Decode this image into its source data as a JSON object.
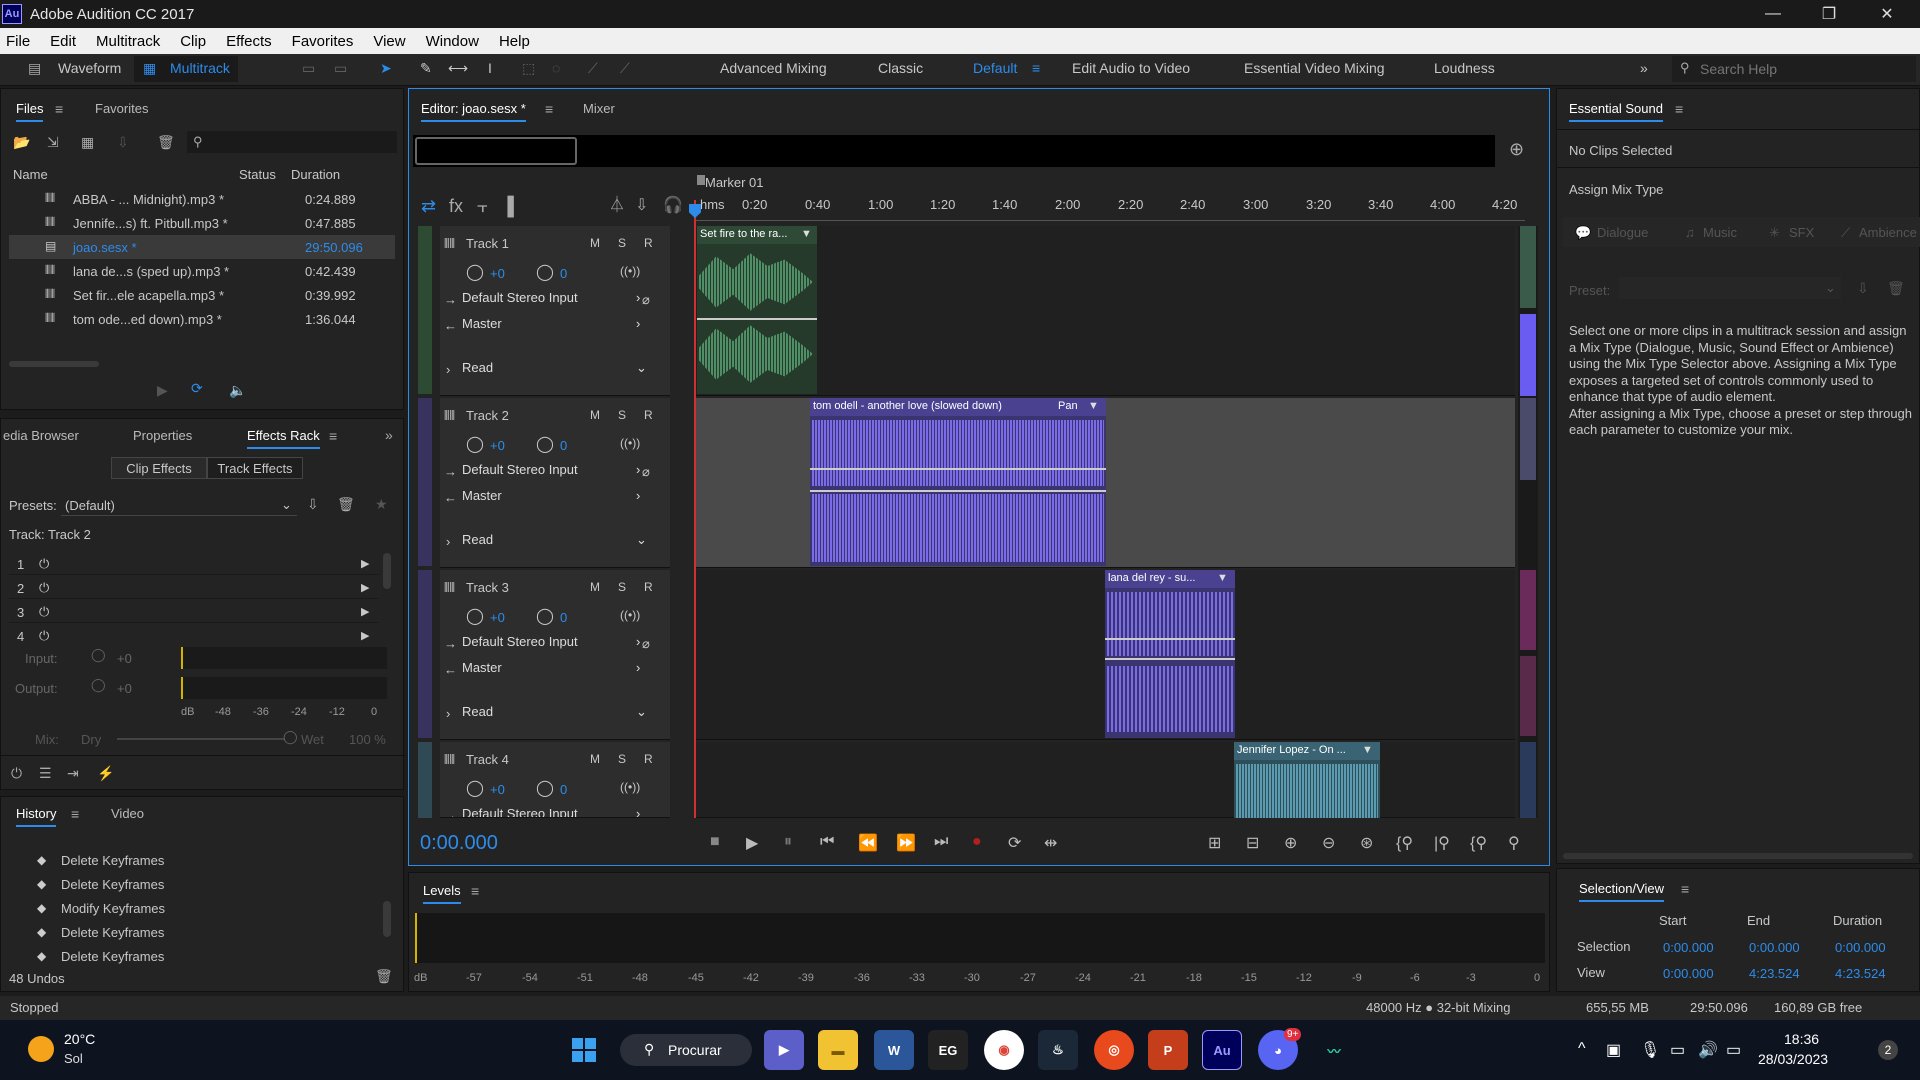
{
  "app": {
    "title": "Adobe Audition CC 2017",
    "logo": "Au"
  },
  "menu": [
    "File",
    "Edit",
    "Multitrack",
    "Clip",
    "Effects",
    "Favorites",
    "View",
    "Window",
    "Help"
  ],
  "toolbar": {
    "waveform": "Waveform",
    "multitrack": "Multitrack",
    "workspaces": [
      "Advanced Mixing",
      "Classic",
      "Default",
      "Edit Audio to Video",
      "Essential Video Mixing",
      "Loudness"
    ],
    "active_workspace": "Default",
    "search_placeholder": "Search Help"
  },
  "files_panel": {
    "tabs": [
      "Files",
      "Favorites"
    ],
    "columns": {
      "name": "Name",
      "status": "Status",
      "duration": "Duration"
    },
    "files": [
      {
        "name": "ABBA - ... Midnight).mp3 *",
        "duration": "0:24.889"
      },
      {
        "name": "Jennife...s) ft. Pitbull.mp3 *",
        "duration": "0:47.885"
      },
      {
        "name": "joao.sesx *",
        "duration": "29:50.096"
      },
      {
        "name": "lana de...s (sped up).mp3 *",
        "duration": "0:42.439"
      },
      {
        "name": "Set fir...ele acapella.mp3 *",
        "duration": "0:39.992"
      },
      {
        "name": "tom ode...ed down).mp3 *",
        "duration": "1:36.044"
      }
    ]
  },
  "effects_panel": {
    "tabs": [
      "edia Browser",
      "Properties",
      "Effects Rack"
    ],
    "subtabs": [
      "Clip Effects",
      "Track Effects"
    ],
    "presets_label": "Presets:",
    "preset_value": "(Default)",
    "track_label": "Track: Track 2",
    "slots": [
      "1",
      "2",
      "3",
      "4"
    ],
    "input_label": "Input:",
    "output_label": "Output:",
    "gain_value": "+0",
    "db_scale": [
      "dB",
      "-48",
      "-36",
      "-24",
      "-12",
      "0"
    ],
    "mix_label": "Mix:",
    "dry_label": "Dry",
    "wet_label": "Wet",
    "wet_value": "100 %"
  },
  "history_panel": {
    "tabs": [
      "History",
      "Video"
    ],
    "items": [
      "Delete Keyframes",
      "Delete Keyframes",
      "Modify Keyframes",
      "Delete Keyframes",
      "Delete Keyframes"
    ],
    "undos": "48 Undos"
  },
  "editor": {
    "tabs": [
      "Editor: joao.sesx *",
      "Mixer"
    ],
    "marker": "Marker 01",
    "ruler": [
      "hms",
      "0:20",
      "0:40",
      "1:00",
      "1:20",
      "1:40",
      "2:00",
      "2:20",
      "2:40",
      "3:00",
      "3:20",
      "3:40",
      "4:00",
      "4:20"
    ],
    "time": "0:00.000",
    "tracks": [
      {
        "name": "Track 1",
        "vol": "+0",
        "pan": "0",
        "input": "Default Stereo Input",
        "output": "Master",
        "mode": "Read",
        "color": "#3cb371"
      },
      {
        "name": "Track 2",
        "vol": "+0",
        "pan": "0",
        "input": "Default Stereo Input",
        "output": "Master",
        "mode": "Read",
        "color": "#7a6cf5"
      },
      {
        "name": "Track 3",
        "vol": "+0",
        "pan": "0",
        "input": "Default Stereo Input",
        "output": "Master",
        "mode": "Read",
        "color": "#7a6cf5"
      },
      {
        "name": "Track 4",
        "vol": "+0",
        "pan": "0",
        "input": "Default Stereo Input",
        "output": "Master",
        "mode": "Read",
        "color": "#4aa0b5"
      }
    ],
    "msr": [
      "M",
      "S",
      "R"
    ],
    "clips": [
      {
        "label": "Set fire to the ra...",
        "extra": ""
      },
      {
        "label": "tom odell - another love (slowed down)",
        "extra": "Pan"
      },
      {
        "label": "lana del rey - su...",
        "extra": ""
      },
      {
        "label": "Jennifer Lopez - On ...",
        "extra": ""
      }
    ]
  },
  "levels": {
    "title": "Levels",
    "scale": [
      "dB",
      "-57",
      "-54",
      "-51",
      "-48",
      "-45",
      "-42",
      "-39",
      "-36",
      "-33",
      "-30",
      "-27",
      "-24",
      "-21",
      "-18",
      "-15",
      "-12",
      "-9",
      "-6",
      "-3",
      "0"
    ]
  },
  "essential_sound": {
    "title": "Essential Sound",
    "no_clips": "No Clips Selected",
    "assign": "Assign Mix Type",
    "types": [
      "Dialogue",
      "Music",
      "SFX",
      "Ambience"
    ],
    "preset_label": "Preset:",
    "description": "Select one or more clips in a multitrack session and assign a Mix Type (Dialogue, Music, Sound Effect or Ambience) using the Mix Type Selector above. Assigning a Mix Type exposes a targeted set of controls commonly used to enhance that type of audio element.\nAfter assigning a Mix Type, choose a preset or step through each parameter to customize your mix."
  },
  "selection_view": {
    "title": "Selection/View",
    "cols": [
      "Start",
      "End",
      "Duration"
    ],
    "selection_label": "Selection",
    "view_label": "View",
    "selection": [
      "0:00.000",
      "0:00.000",
      "0:00.000"
    ],
    "view": [
      "0:00.000",
      "4:23.524",
      "4:23.524"
    ]
  },
  "status_bar": {
    "state": "Stopped",
    "format": "48000 Hz ● 32-bit Mixing",
    "memory": "655,55 MB",
    "duration": "29:50.096",
    "free": "160,89 GB free"
  },
  "taskbar": {
    "temp": "20°C",
    "weather": "Sol",
    "search": "Procurar",
    "time": "18:36",
    "date": "28/03/2023",
    "notif": "2",
    "discord_badge": "9+"
  },
  "colors": {
    "accent": "#2d8ceb",
    "track_green": "#3cb371",
    "track_purple": "#6a5acd",
    "track_teal": "#4a8fa0"
  }
}
